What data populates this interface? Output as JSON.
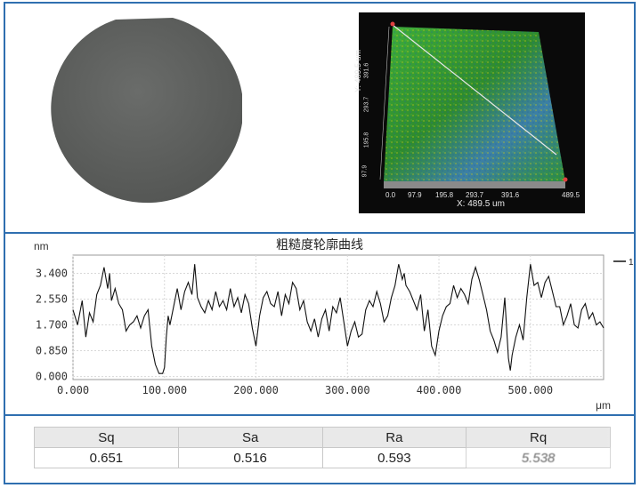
{
  "top_panel": {
    "surface_map": {
      "x_axis_label": "X: 489.5 um",
      "y_axis_label": "Y: 489.5 um",
      "x_ticks": [
        "0.0",
        "97.9",
        "195.8",
        "293.7",
        "391.6",
        "489.5"
      ],
      "y_ticks": [
        "97.9",
        "195.8",
        "293.7",
        "391.6"
      ],
      "colors": {
        "surface_green": "#2e8b2e",
        "peak_yellow": "#c8c814",
        "valley_blue": "#2f70b8",
        "background": "#0a0a0a"
      }
    },
    "wafer": {
      "color": "#5a5c5a"
    }
  },
  "chart_data": {
    "type": "line",
    "title": "粗糙度轮廓曲线",
    "ylabel": "nm",
    "xlabel": "μm",
    "xlim": [
      0,
      580
    ],
    "ylim": [
      -0.1,
      4.0
    ],
    "x_ticks": [
      "0.000",
      "100.000",
      "200.000",
      "300.000",
      "400.000",
      "500.000"
    ],
    "y_ticks": [
      "0.000",
      "0.850",
      "1.700",
      "2.550",
      "3.400"
    ],
    "grid": true,
    "legend": {
      "position": "top-right",
      "entries": [
        "1"
      ]
    },
    "series": [
      {
        "name": "1",
        "color": "#111111",
        "x": [
          0,
          5,
          10,
          14,
          18,
          22,
          26,
          30,
          34,
          38,
          40,
          42,
          46,
          50,
          54,
          58,
          62,
          66,
          70,
          74,
          78,
          82,
          86,
          90,
          94,
          98,
          100,
          102,
          104,
          106,
          110,
          114,
          118,
          122,
          126,
          130,
          133,
          136,
          140,
          144,
          148,
          152,
          156,
          160,
          164,
          168,
          172,
          176,
          180,
          184,
          188,
          192,
          196,
          200,
          204,
          208,
          212,
          216,
          220,
          224,
          228,
          232,
          236,
          240,
          244,
          248,
          252,
          256,
          260,
          264,
          268,
          272,
          276,
          280,
          284,
          288,
          292,
          296,
          300,
          304,
          308,
          312,
          316,
          320,
          324,
          328,
          332,
          336,
          340,
          344,
          348,
          352,
          356,
          360,
          362,
          364,
          368,
          372,
          376,
          380,
          384,
          388,
          392,
          396,
          400,
          404,
          408,
          412,
          416,
          420,
          424,
          428,
          432,
          436,
          440,
          444,
          448,
          452,
          456,
          460,
          464,
          468,
          472,
          476,
          478,
          480,
          484,
          488,
          492,
          496,
          500,
          504,
          508,
          512,
          516,
          520,
          524,
          528,
          532,
          536,
          540,
          544,
          548,
          552,
          556,
          560,
          564,
          568,
          572,
          576,
          580
        ],
        "values": [
          2.2,
          1.7,
          2.5,
          1.3,
          2.1,
          1.8,
          2.7,
          3.0,
          3.6,
          2.9,
          3.4,
          2.5,
          2.9,
          2.4,
          2.2,
          1.5,
          1.7,
          1.8,
          2.0,
          1.6,
          2.0,
          2.2,
          1.0,
          0.4,
          0.1,
          0.1,
          0.3,
          1.3,
          2.0,
          1.7,
          2.3,
          2.9,
          2.2,
          2.8,
          3.1,
          2.7,
          3.7,
          2.6,
          2.3,
          2.1,
          2.5,
          2.2,
          2.8,
          2.3,
          2.5,
          2.2,
          2.9,
          2.3,
          2.6,
          2.1,
          2.7,
          2.4,
          1.6,
          1.0,
          2.0,
          2.6,
          2.8,
          2.4,
          2.3,
          2.8,
          2.0,
          2.7,
          2.4,
          3.1,
          2.9,
          2.2,
          2.5,
          1.8,
          1.5,
          1.9,
          1.3,
          1.9,
          2.2,
          1.5,
          2.3,
          2.1,
          2.6,
          1.8,
          1.0,
          1.5,
          1.8,
          1.3,
          1.4,
          2.2,
          2.5,
          2.3,
          2.8,
          2.4,
          1.8,
          2.0,
          2.6,
          3.0,
          3.7,
          3.2,
          3.4,
          3.0,
          2.8,
          2.5,
          2.2,
          2.7,
          1.5,
          2.2,
          1.0,
          0.7,
          1.5,
          2.0,
          2.3,
          2.4,
          3.0,
          2.6,
          2.9,
          2.7,
          2.4,
          3.2,
          3.6,
          3.2,
          2.7,
          2.2,
          1.5,
          1.2,
          0.8,
          1.3,
          2.6,
          0.6,
          0.2,
          0.7,
          1.3,
          1.7,
          1.2,
          2.6,
          3.7,
          3.0,
          3.1,
          2.6,
          3.1,
          3.3,
          2.8,
          2.3,
          2.3,
          1.7,
          2.0,
          2.4,
          1.7,
          1.6,
          2.2,
          2.4,
          1.9,
          2.1,
          1.7,
          1.8,
          1.6
        ]
      }
    ]
  },
  "results_table": {
    "headers": [
      "Sq",
      "Sa",
      "Ra",
      "Rq"
    ],
    "values": [
      "0.651",
      "0.516",
      "0.593",
      "5.538"
    ]
  }
}
